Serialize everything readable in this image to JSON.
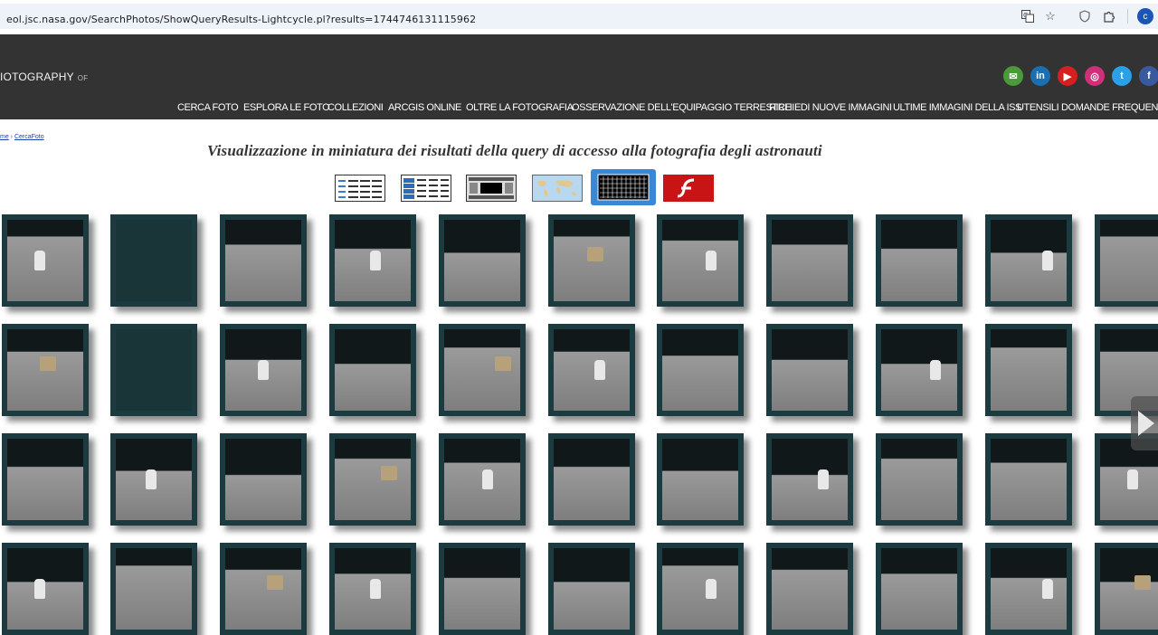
{
  "browser": {
    "url": "eol.jsc.nasa.gov/SearchPhotos/ShowQueryResults-Lightcycle.pl?results=1744746131115962",
    "profile_initial": "c"
  },
  "header": {
    "brand": "IOTOGRAPHY",
    "brand_suffix": "OF",
    "social": [
      {
        "name": "email",
        "color": "#4a9a3a",
        "glyph": "✉"
      },
      {
        "name": "linkedin",
        "color": "#1a6fb0",
        "glyph": "in"
      },
      {
        "name": "youtube",
        "color": "#d42020",
        "glyph": "▶"
      },
      {
        "name": "instagram",
        "color": "#d0307a",
        "glyph": "◎"
      },
      {
        "name": "twitter",
        "color": "#2aa0e8",
        "glyph": "t"
      },
      {
        "name": "facebook",
        "color": "#3a5aa0",
        "glyph": "f"
      }
    ],
    "nav": [
      "CERCA FOTO",
      "ESPLORA LE FOTO",
      "COLLEZIONI",
      "ARCGIS ONLINE",
      "OLTRE LA FOTOGRAFIA",
      "OSSERVAZIONE DELL'EQUIPAGGIO TERRESTRE",
      "RICHIEDI NUOVE IMMAGINI",
      "ULTIME IMMAGINI DELLA ISS",
      "UTENSILI",
      "DOMANDE FREQUENTI"
    ]
  },
  "breadcrumb": {
    "home": "me",
    "separator": " › ",
    "current": "CercaFoto"
  },
  "page": {
    "title": "Visualizzazione in miniatura dei risultati della query di accesso alla fotografia degli astronauti"
  },
  "view_buttons": [
    {
      "name": "list-view",
      "selected": false
    },
    {
      "name": "detail-list-view",
      "selected": false
    },
    {
      "name": "film-strip-view",
      "selected": false
    },
    {
      "name": "map-view",
      "selected": false
    },
    {
      "name": "thumbnail-grid-view",
      "selected": true
    },
    {
      "name": "flash-view",
      "selected": false
    }
  ]
}
